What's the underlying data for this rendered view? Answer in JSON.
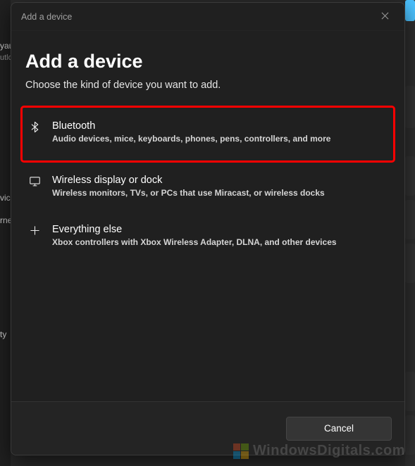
{
  "bg": {
    "left": {
      "l1": "yau",
      "l2": "utlo",
      "l3": "vice",
      "l4": "rne",
      "l5": "",
      "l6": "ty"
    }
  },
  "dialog": {
    "titlebar": {
      "label": "Add a device"
    },
    "heading": "Add a device",
    "subheading": "Choose the kind of device you want to add.",
    "options": [
      {
        "title": "Bluetooth",
        "desc": "Audio devices, mice, keyboards, phones, pens, controllers, and more"
      },
      {
        "title": "Wireless display or dock",
        "desc": "Wireless monitors, TVs, or PCs that use Miracast, or wireless docks"
      },
      {
        "title": "Everything else",
        "desc": "Xbox controllers with Xbox Wireless Adapter, DLNA, and other devices"
      }
    ],
    "cancel": "Cancel"
  },
  "watermark": "WindowsDigitals.com"
}
